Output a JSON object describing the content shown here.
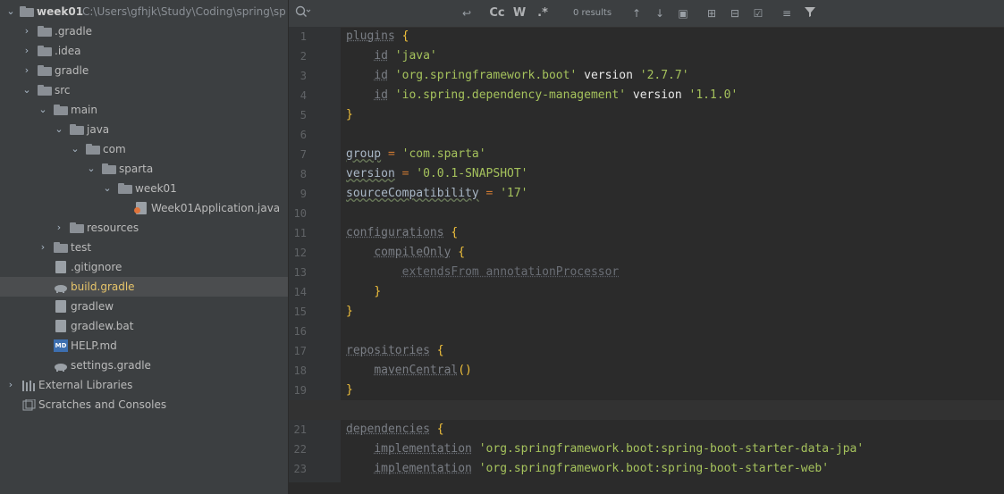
{
  "project": {
    "root_name": "week01",
    "root_path": "C:\\Users\\gfhjk\\Study\\Coding\\spring\\sp"
  },
  "tree": [
    {
      "label": ".gradle",
      "kind": "folder",
      "depth": 1,
      "chev": "›"
    },
    {
      "label": ".idea",
      "kind": "folder",
      "depth": 1,
      "chev": "›"
    },
    {
      "label": "gradle",
      "kind": "folder",
      "depth": 1,
      "chev": "›"
    },
    {
      "label": "src",
      "kind": "folder",
      "depth": 1,
      "chev": "⌄"
    },
    {
      "label": "main",
      "kind": "folder",
      "depth": 2,
      "chev": "⌄"
    },
    {
      "label": "java",
      "kind": "folder",
      "depth": 3,
      "chev": "⌄"
    },
    {
      "label": "com",
      "kind": "folder",
      "depth": 4,
      "chev": "⌄"
    },
    {
      "label": "sparta",
      "kind": "folder",
      "depth": 5,
      "chev": "⌄"
    },
    {
      "label": "week01",
      "kind": "folder",
      "depth": 6,
      "chev": "⌄"
    },
    {
      "label": "Week01Application.java",
      "kind": "java",
      "depth": 7,
      "chev": ""
    },
    {
      "label": "resources",
      "kind": "folder",
      "depth": 3,
      "chev": "›"
    },
    {
      "label": "test",
      "kind": "folder",
      "depth": 2,
      "chev": "›"
    },
    {
      "label": ".gitignore",
      "kind": "file",
      "depth": 2,
      "chev": ""
    },
    {
      "label": "build.gradle",
      "kind": "gradle",
      "depth": 2,
      "chev": "",
      "selected": true
    },
    {
      "label": "gradlew",
      "kind": "file",
      "depth": 2,
      "chev": ""
    },
    {
      "label": "gradlew.bat",
      "kind": "file",
      "depth": 2,
      "chev": ""
    },
    {
      "label": "HELP.md",
      "kind": "md",
      "depth": 2,
      "chev": ""
    },
    {
      "label": "settings.gradle",
      "kind": "gradle",
      "depth": 2,
      "chev": ""
    },
    {
      "label": "External Libraries",
      "kind": "lib",
      "depth": 0,
      "chev": "›"
    },
    {
      "label": "Scratches and Consoles",
      "kind": "scratch",
      "depth": 0,
      "chev": ""
    }
  ],
  "findbar": {
    "search_icon": "search-icon",
    "results": "0 results",
    "match_case": "Cc",
    "words": "W",
    "regex": ".*"
  },
  "editor": {
    "current_line": 20,
    "lines": [
      "plugins {",
      "    id 'java'",
      "    id 'org.springframework.boot' version '2.7.7'",
      "    id 'io.spring.dependency-management' version '1.1.0'",
      "}",
      "",
      "group = 'com.sparta'",
      "version = '0.0.1-SNAPSHOT'",
      "sourceCompatibility = '17'",
      "",
      "configurations {",
      "    compileOnly {",
      "        extendsFrom annotationProcessor",
      "    }",
      "}",
      "",
      "repositories {",
      "    mavenCentral()",
      "}",
      "",
      "dependencies {",
      "    implementation 'org.springframework.boot:spring-boot-starter-data-jpa'",
      "    implementation 'org.springframework.boot:spring-boot-starter-web'"
    ]
  }
}
